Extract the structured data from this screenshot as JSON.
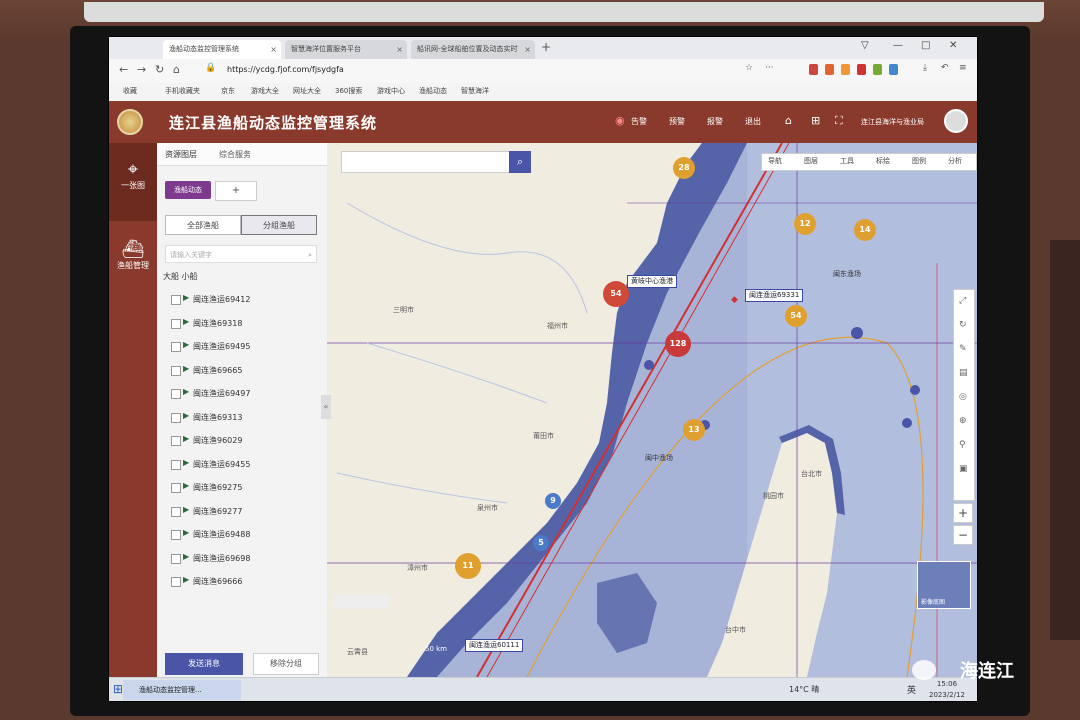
{
  "browser": {
    "tabs": [
      {
        "label": "渔船动态监控管理系统",
        "active": true
      },
      {
        "label": "智慧海洋位置服务平台",
        "active": false
      },
      {
        "label": "船讯网-全球船舶位置及动态实时",
        "active": false
      }
    ],
    "url": "https://ycdg.fjof.com/fjsydgfa",
    "bookmarks": [
      "收藏",
      "手机收藏夹",
      "京东",
      "游戏大全",
      "网址大全",
      "360搜索",
      "游戏中心",
      "渔船动态",
      "智慧海洋"
    ]
  },
  "header": {
    "title": "连江县渔船动态监控管理系统",
    "items": [
      "告警",
      "预警",
      "报警",
      "退出"
    ],
    "org": "连江县海洋与渔业局"
  },
  "leftnav": {
    "items": [
      {
        "label": "一张图",
        "icon": "map-pin-icon"
      },
      {
        "label": "渔船管理",
        "icon": "ship-icon"
      }
    ]
  },
  "panel": {
    "tabs": [
      "资源图层",
      "综合服务"
    ],
    "chip": "渔船动态",
    "chip_add": "+",
    "segments": [
      "全部渔船",
      "分组渔船"
    ],
    "search_placeholder": "请输入关键字",
    "sort_label": "大船 小船",
    "vessels": [
      "闽连渔运69412",
      "闽连渔69318",
      "闽连渔运69495",
      "闽连渔69665",
      "闽连渔运69497",
      "闽连渔69313",
      "闽连渔96029",
      "闽连渔运69455",
      "闽连渔69275",
      "闽连渔69277",
      "闽连渔运69488",
      "闽连渔运69698",
      "闽连渔69666"
    ],
    "send_label": "发送消息",
    "remove_label": "移除分组"
  },
  "map": {
    "toolbar": [
      "导航",
      "图层",
      "工具",
      "标绘",
      "图例",
      "分析"
    ],
    "clusters": [
      {
        "count": "28",
        "color": "#e0a030"
      },
      {
        "count": "12",
        "color": "#e0a030"
      },
      {
        "count": "14",
        "color": "#e0a030"
      },
      {
        "count": "54",
        "color": "#e0a030"
      },
      {
        "count": "54",
        "color": "#d04a3a"
      },
      {
        "count": "128",
        "color": "#c83a3a"
      },
      {
        "count": "13",
        "color": "#e0a030"
      },
      {
        "count": "11",
        "color": "#e0a030"
      },
      {
        "count": "9",
        "color": "#4a7ac8"
      },
      {
        "count": "5",
        "color": "#4a7ac8"
      }
    ],
    "labels": {
      "center": "黄岐中心渔港",
      "vessel_a": "闽连渔运69331",
      "vessel_b": "闽连渔运60111"
    },
    "cities": [
      "福州市",
      "三明市",
      "莆田市",
      "泉州市",
      "台北市",
      "桃园市",
      "台中市",
      "漳州市",
      "云霄县"
    ],
    "sea_zones": [
      "闽东渔场",
      "闽中渔场"
    ],
    "scale": "50 km",
    "minimap_label": "影像底图"
  },
  "taskbar": {
    "app": "渔船动态监控管理...",
    "weather": "14°C 晴",
    "ime": "英",
    "time": "15:06",
    "date": "2023/2/12"
  },
  "watermark": "海连江"
}
